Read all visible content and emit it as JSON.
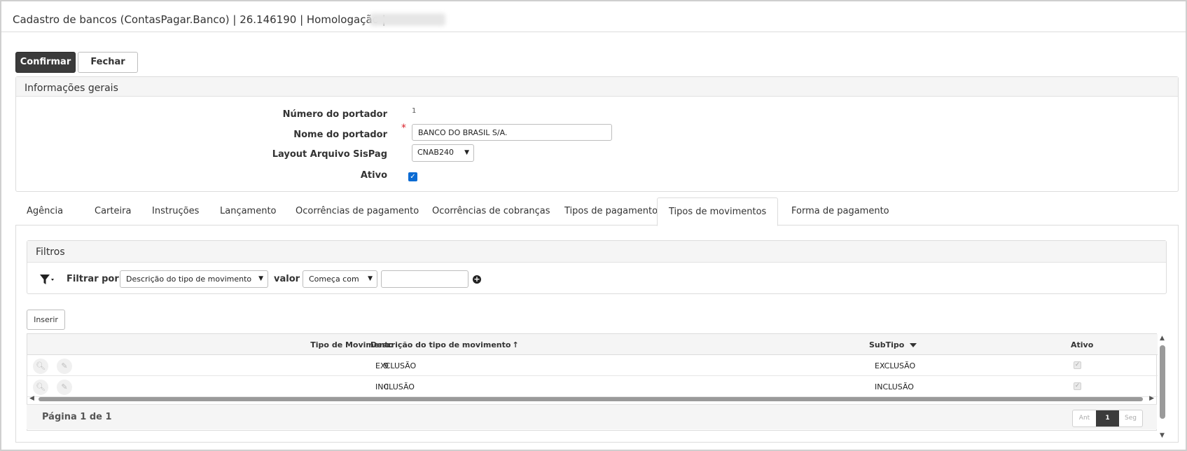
{
  "window": {
    "title": "Cadastro de bancos (ContasPagar.Banco) | 26.146190 | Homologação |"
  },
  "toolbar": {
    "confirm_label": "Confirmar",
    "close_label": "Fechar"
  },
  "general": {
    "header": "Informações gerais",
    "numero_label": "Número do portador",
    "numero_value": "1",
    "nome_label": "Nome do portador",
    "nome_value": "BANCO DO BRASIL S/A.",
    "layout_label": "Layout Arquivo SisPag",
    "layout_value": "CNAB240",
    "ativo_label": "Ativo",
    "ativo_checked": true
  },
  "tabs": [
    {
      "label": "Agência"
    },
    {
      "label": "Carteira"
    },
    {
      "label": "Instruções"
    },
    {
      "label": "Lançamento"
    },
    {
      "label": "Ocorrências de pagamento"
    },
    {
      "label": "Ocorrências de cobranças"
    },
    {
      "label": "Tipos de pagamentos"
    },
    {
      "label": "Tipos de movimentos",
      "active": true
    },
    {
      "label": "Forma de pagamento"
    }
  ],
  "filters": {
    "header": "Filtros",
    "filter_by_label": "Filtrar por",
    "field_value": "Descrição do tipo de movimento",
    "valor_label": "valor",
    "condition_value": "Começa com",
    "text_value": ""
  },
  "grid": {
    "insert_label": "Inserir",
    "columns": {
      "tipo": "Tipo de Movimento",
      "descricao": "Descrição do tipo de movimento",
      "subtipo": "SubTipo",
      "ativo": "Ativo"
    },
    "sort_arrow": "↑",
    "rows": [
      {
        "tipo": "9",
        "descricao": "EXCLUSÃO",
        "subtipo": "EXCLUSÃO",
        "ativo": true
      },
      {
        "tipo": "0",
        "descricao": "INCLUSÃO",
        "subtipo": "INCLUSÃO",
        "ativo": true
      }
    ],
    "page_info": "Página 1 de 1",
    "pager": {
      "prev": "Ant",
      "current": "1",
      "next": "Seg"
    }
  },
  "colors": {
    "primary_button": "#3b3b3b",
    "checkbox_blue": "#0b6bd3",
    "required_red": "#d9232b"
  }
}
